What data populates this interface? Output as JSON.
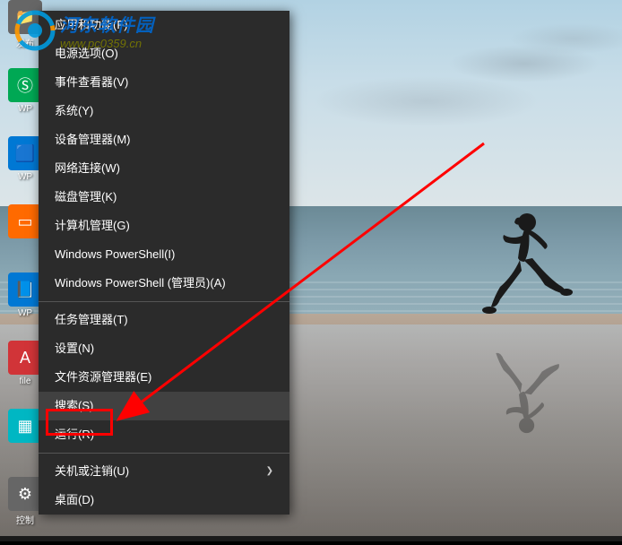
{
  "watermark": {
    "title": "河东软件园",
    "url": "www.pc0359.cn"
  },
  "context_menu": {
    "items": [
      {
        "label": "应用和功能(F)",
        "has_submenu": false
      },
      {
        "label": "电源选项(O)",
        "has_submenu": false
      },
      {
        "label": "事件查看器(V)",
        "has_submenu": false
      },
      {
        "label": "系统(Y)",
        "has_submenu": false
      },
      {
        "label": "设备管理器(M)",
        "has_submenu": false
      },
      {
        "label": "网络连接(W)",
        "has_submenu": false
      },
      {
        "label": "磁盘管理(K)",
        "has_submenu": false
      },
      {
        "label": "计算机管理(G)",
        "has_submenu": false
      },
      {
        "label": "Windows PowerShell(I)",
        "has_submenu": false
      },
      {
        "label": "Windows PowerShell (管理员)(A)",
        "has_submenu": false
      }
    ],
    "items2": [
      {
        "label": "任务管理器(T)",
        "has_submenu": false
      },
      {
        "label": "设置(N)",
        "has_submenu": false
      },
      {
        "label": "文件资源管理器(E)",
        "has_submenu": false
      },
      {
        "label": "搜索(S)",
        "has_submenu": false,
        "highlighted": true
      },
      {
        "label": "运行(R)",
        "has_submenu": false
      }
    ],
    "items3": [
      {
        "label": "关机或注销(U)",
        "has_submenu": true
      },
      {
        "label": "桌面(D)",
        "has_submenu": false
      }
    ]
  },
  "desktop_icons": [
    {
      "label": "发布",
      "color": "gray"
    },
    {
      "label": "WP",
      "color": "green"
    },
    {
      "label": "WP",
      "color": "blue"
    },
    {
      "label": "",
      "color": "orange"
    },
    {
      "label": "WP",
      "color": "blue"
    },
    {
      "label": "file",
      "color": "red"
    },
    {
      "label": "",
      "color": "cyan"
    },
    {
      "label": "控制",
      "color": "gray"
    }
  ]
}
